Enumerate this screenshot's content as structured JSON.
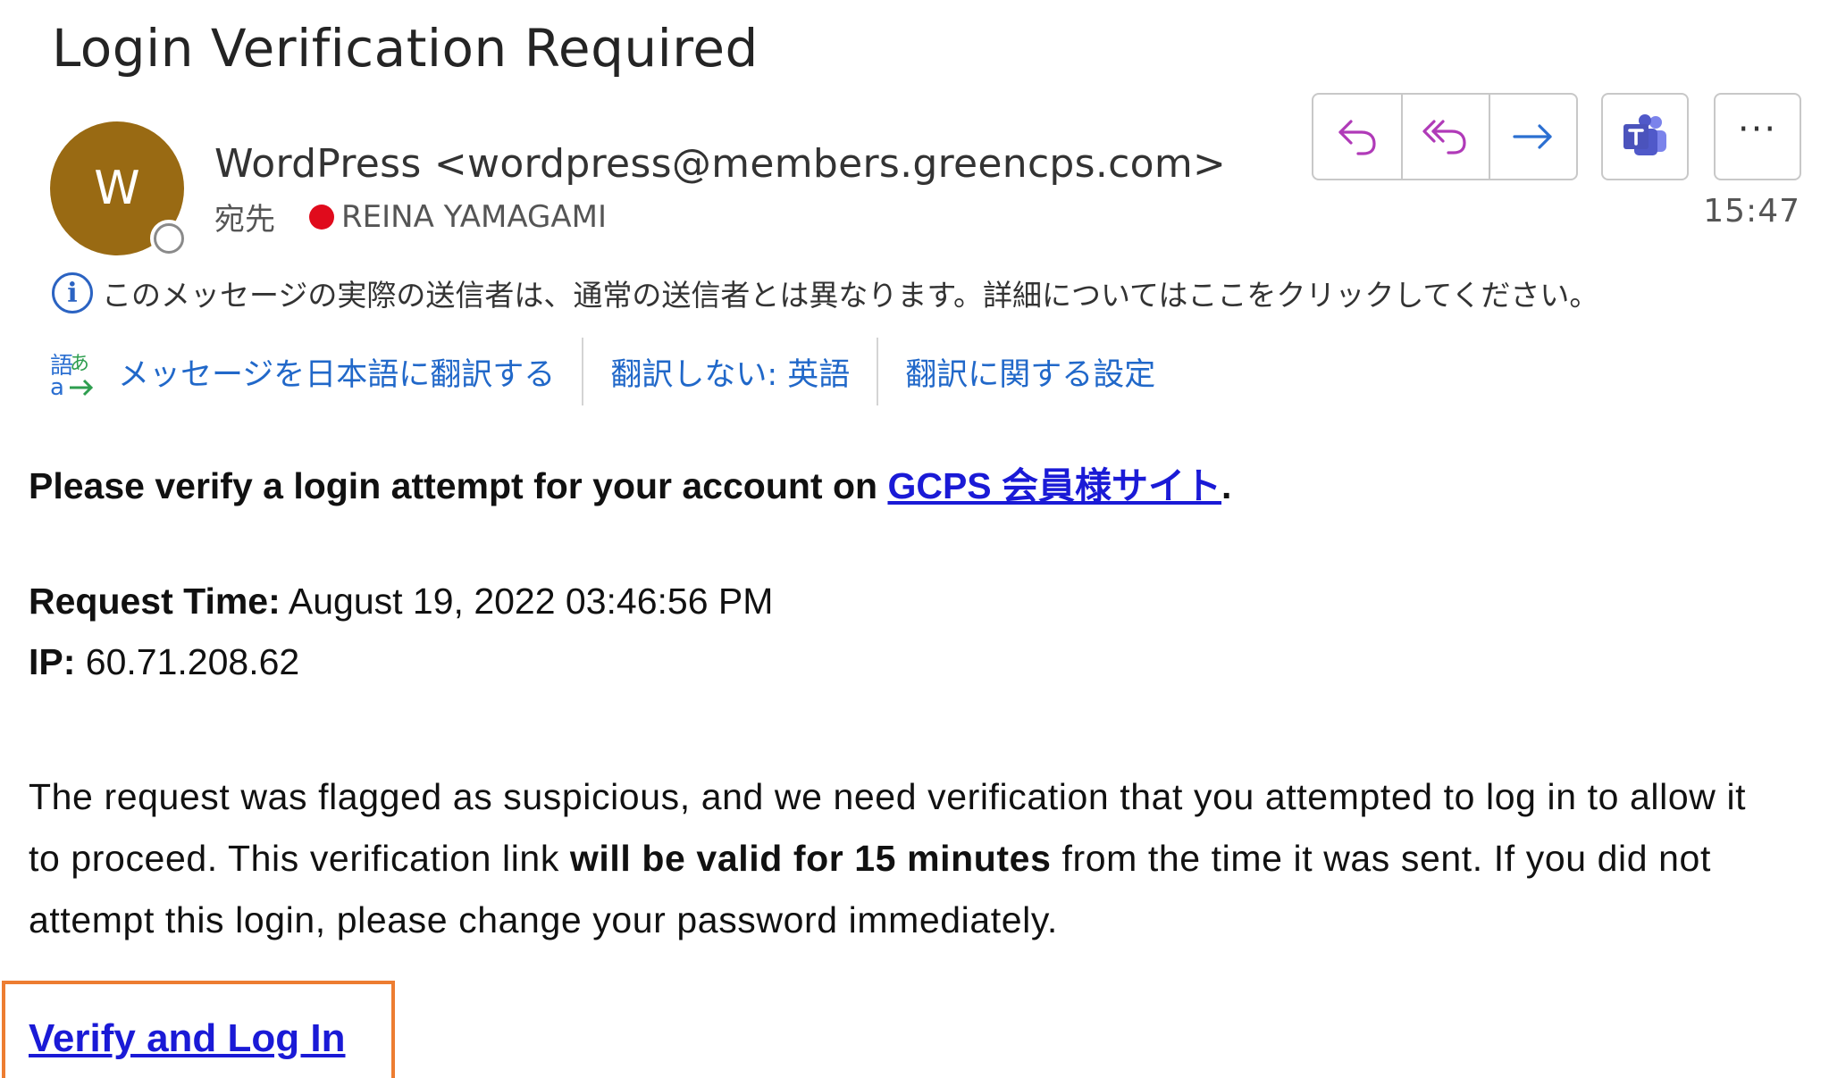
{
  "email": {
    "subject": "Login Verification Required",
    "avatar_initial": "W",
    "avatar_color": "#996a13",
    "sender": "WordPress <wordpress@members.greencps.com>",
    "to_label": "宛先",
    "recipient": "REINA YAMAGAMI",
    "recipient_status_color": "#e00b1c",
    "time": "15:47"
  },
  "actions": {
    "reply_icon": "reply-icon",
    "reply_all_icon": "reply-all-icon",
    "forward_icon": "forward-icon",
    "teams_icon": "teams-icon",
    "more_label": "···"
  },
  "notice": {
    "icon": "info-icon",
    "text": "このメッセージの実際の送信者は、通常の送信者とは異なります。詳細についてはここをクリックしてください。"
  },
  "translate": {
    "icon": "translate-icon",
    "translate_link": "メッセージを日本語に翻訳する",
    "dont_translate_link": "翻訳しない: 英語",
    "settings_link": "翻訳に関する設定"
  },
  "body": {
    "line1_prefix": "Please verify a login attempt for your account on ",
    "site_link": "GCPS 会員様サイト",
    "line1_suffix": ".",
    "request_time_label": "Request Time:",
    "request_time_value": " August 19, 2022 03:46:56 PM",
    "ip_label": "IP:",
    "ip_value": " 60.71.208.62",
    "para_part1": "The request was flagged as suspicious, and we need verification that you attempted to log in to allow it to proceed. This verification link ",
    "para_bold": "will be valid for 15 minutes",
    "para_part2": " from the time it was sent. If you did not attempt this login, please change your password immediately.",
    "verify_link": "Verify and Log In",
    "highlight_color": "#ed7d31"
  }
}
